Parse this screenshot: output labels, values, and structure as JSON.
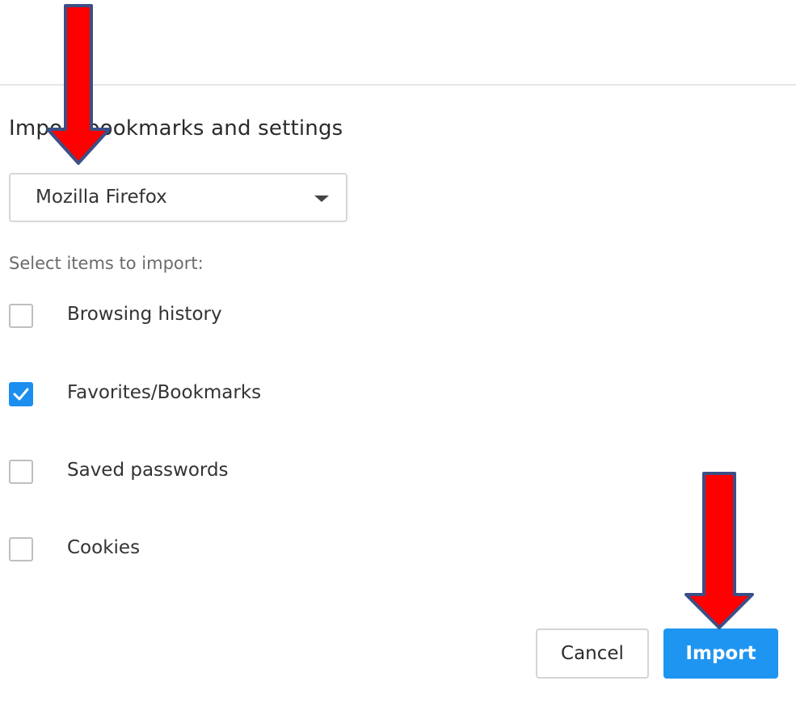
{
  "dialog": {
    "title": "Import bookmarks and settings",
    "browser_select": {
      "value": "Mozilla Firefox"
    },
    "section_label": "Select items to import:",
    "items": [
      {
        "label": "Browsing history",
        "checked": false
      },
      {
        "label": "Favorites/Bookmarks",
        "checked": true
      },
      {
        "label": "Saved passwords",
        "checked": false
      },
      {
        "label": "Cookies",
        "checked": false
      }
    ],
    "buttons": {
      "cancel": "Cancel",
      "import": "Import"
    }
  },
  "colors": {
    "accent": "#1f95f2",
    "arrow_fill": "#ff0000",
    "arrow_outline": "#3c4f86"
  },
  "annotations": [
    {
      "name": "red-arrow-icon",
      "points_to": "browser select dropdown"
    },
    {
      "name": "red-arrow-icon",
      "points_to": "Import button"
    }
  ]
}
